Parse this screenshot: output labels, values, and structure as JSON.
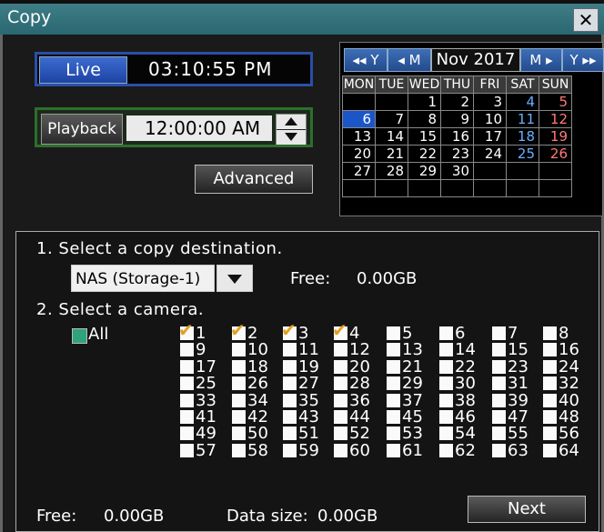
{
  "window": {
    "title": "Copy",
    "close_label": "✕"
  },
  "live": {
    "label": "Live",
    "time": "03:10:55 PM"
  },
  "playback": {
    "label": "Playback",
    "time": "12:00:00 AM"
  },
  "advanced_label": "Advanced",
  "calendar": {
    "nav": {
      "prev_year": "◂◂ Y",
      "prev_month": "◂ M",
      "month": "Nov 2017",
      "next_month": "M ▸",
      "next_year": "Y ▸▸"
    },
    "weekdays": [
      "MON",
      "TUE",
      "WED",
      "THU",
      "FRI",
      "SAT",
      "SUN"
    ],
    "weeks": [
      [
        "",
        "",
        "1",
        "2",
        "3",
        "4",
        "5"
      ],
      [
        "6",
        "7",
        "8",
        "9",
        "10",
        "11",
        "12"
      ],
      [
        "13",
        "14",
        "15",
        "16",
        "17",
        "18",
        "19"
      ],
      [
        "20",
        "21",
        "22",
        "23",
        "24",
        "25",
        "26"
      ],
      [
        "27",
        "28",
        "29",
        "30",
        "",
        "",
        ""
      ],
      [
        "",
        "",
        "",
        "",
        "",
        "",
        ""
      ]
    ],
    "selected_day": "6"
  },
  "step1": {
    "label": "1. Select a copy destination.",
    "destination": "NAS (Storage-1)",
    "free_label": "Free:",
    "free_value": "0.00GB"
  },
  "step2": {
    "label": "2. Select a camera.",
    "all_label": "All"
  },
  "cameras": [
    "1",
    "2",
    "3",
    "4",
    "5",
    "6",
    "7",
    "8",
    "9",
    "10",
    "11",
    "12",
    "13",
    "14",
    "15",
    "16",
    "17",
    "18",
    "19",
    "20",
    "21",
    "22",
    "23",
    "24",
    "25",
    "26",
    "27",
    "28",
    "29",
    "30",
    "31",
    "32",
    "33",
    "34",
    "35",
    "36",
    "37",
    "38",
    "39",
    "40",
    "41",
    "42",
    "43",
    "44",
    "45",
    "46",
    "47",
    "48",
    "49",
    "50",
    "51",
    "52",
    "53",
    "54",
    "55",
    "56",
    "57",
    "58",
    "59",
    "60",
    "61",
    "62",
    "63",
    "64"
  ],
  "checked_cameras": [
    "1",
    "2",
    "3",
    "4"
  ],
  "footer": {
    "free_label": "Free:",
    "free_value": "0.00GB",
    "data_size_label": "Data size:",
    "data_size_value": "0.00GB",
    "next_label": "Next"
  }
}
